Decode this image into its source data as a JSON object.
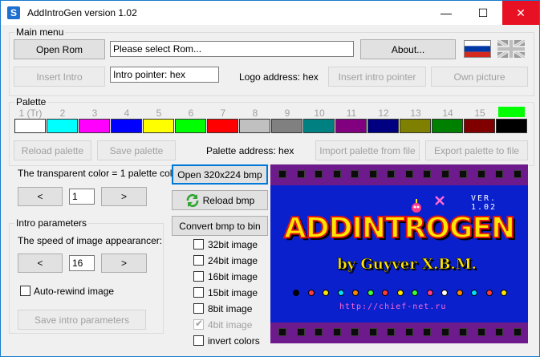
{
  "window": {
    "title": "AddIntroGen version 1.02",
    "app_icon_letter": "S",
    "minimize_glyph": "—",
    "maximize_glyph": "☐",
    "close_glyph": "✕"
  },
  "main_menu": {
    "title": "Main menu",
    "open_rom_label": "Open Rom",
    "rom_path_value": "Please select Rom...",
    "about_label": "About...",
    "insert_intro_label": "Insert Intro",
    "intro_pointer_value": "Intro pointer: hex",
    "logo_address_label": "Logo address: hex",
    "insert_intro_pointer_label": "Insert intro pointer",
    "own_picture_label": "Own picture"
  },
  "palette": {
    "title": "Palette",
    "numbers": [
      "1 (Tr)",
      "2",
      "3",
      "4",
      "5",
      "6",
      "7",
      "8",
      "9",
      "10",
      "11",
      "12",
      "13",
      "14",
      "15",
      "16"
    ],
    "colors": [
      "#ffffff",
      "#00ffff",
      "#ff00ff",
      "#0000ff",
      "#ffff00",
      "#00ff00",
      "#ff0000",
      "#c0c0c0",
      "#808080",
      "#008080",
      "#800080",
      "#000080",
      "#808000",
      "#008000",
      "#800000",
      "#000000"
    ],
    "highlight_color": "#00ff00",
    "reload_palette_label": "Reload palette",
    "save_palette_label": "Save palette",
    "palette_address_label": "Palette address: hex",
    "import_palette_label": "Import palette from file",
    "export_palette_label": "Export palette to file"
  },
  "transparent": {
    "text": "The transparent color = 1 palette color",
    "decrement_label": "<",
    "value": "1",
    "increment_label": ">"
  },
  "intro_parameters": {
    "title": "Intro parameters",
    "speed_label": "The speed of image appearancer:",
    "decrement_label": "<",
    "value": "16",
    "increment_label": ">",
    "auto_rewind_label": "Auto-rewind image",
    "save_label": "Save intro parameters"
  },
  "bmp": {
    "open_label": "Open 320x224 bmp",
    "reload_label": "Reload bmp",
    "convert_label": "Convert bmp to bin",
    "options": [
      {
        "label": "32bit image",
        "checked": false,
        "disabled": false
      },
      {
        "label": "24bit image",
        "checked": false,
        "disabled": false
      },
      {
        "label": "16bit image",
        "checked": false,
        "disabled": false
      },
      {
        "label": "15bit image",
        "checked": false,
        "disabled": false
      },
      {
        "label": "8bit image",
        "checked": false,
        "disabled": false
      },
      {
        "label": "4bit image",
        "checked": true,
        "disabled": true
      },
      {
        "label": "invert colors",
        "checked": false,
        "disabled": false
      }
    ]
  },
  "preview": {
    "version_text": "VER. 1.02",
    "logo_text": "ADDINTROGEN",
    "byline_text": "by Guyver X.B.M.",
    "url_text": "http://chief-net.ru",
    "background_color": "#0a20cc",
    "strip_color": "#6d1b8c"
  }
}
